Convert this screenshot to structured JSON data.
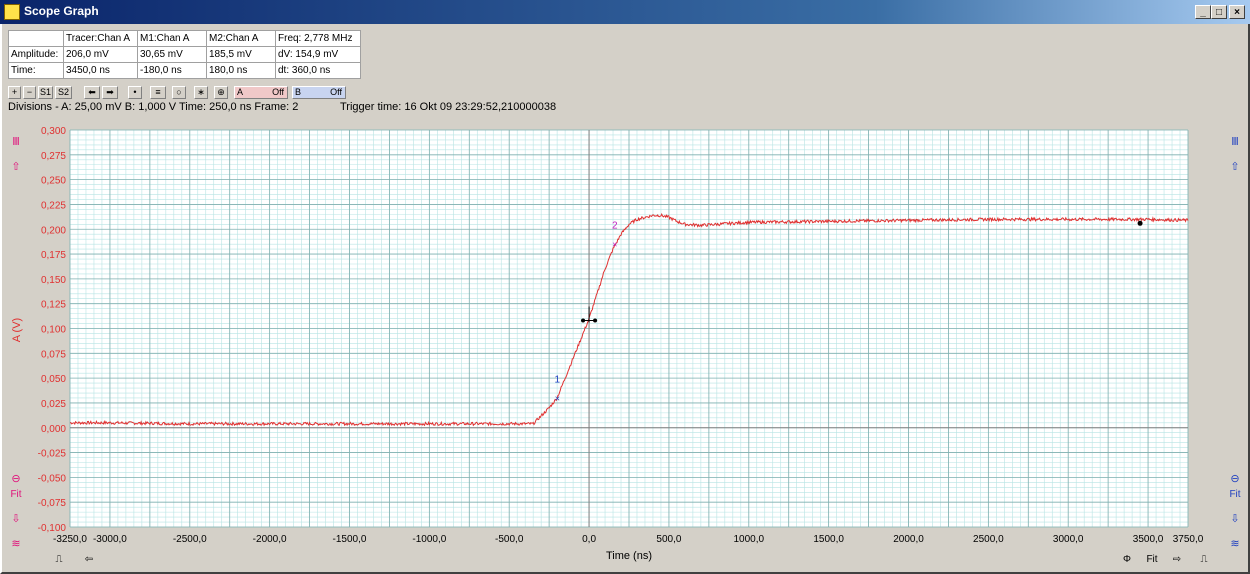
{
  "window": {
    "title": "Scope Graph"
  },
  "info_table": {
    "rows": [
      [
        "",
        "Tracer:Chan A",
        "M1:Chan A",
        "M2:Chan A",
        "Freq: 2,778 MHz"
      ],
      [
        "Amplitude:",
        "206,0 mV",
        "30,65 mV",
        "185,5 mV",
        "dV: 154,9 mV"
      ],
      [
        "Time:",
        "3450,0 ns",
        "-180,0 ns",
        "180,0 ns",
        "dt: 360,0 ns"
      ]
    ]
  },
  "toolbar": {
    "s1": "S1",
    "s2": "S2",
    "chan_a_label": "A",
    "chan_a_state": "Off",
    "chan_b_label": "B",
    "chan_b_state": "Off"
  },
  "status": {
    "divisions": "Divisions -  A: 25,00 mV    B: 1,000 V    Time: 250,0 ns   Frame: 2",
    "trigger": "Trigger time: 16 Okt 09 23:29:52,210000038"
  },
  "side_buttons": {
    "fit": "Fit"
  },
  "chart_data": {
    "type": "line",
    "xlabel": "Time (ns)",
    "ylabel": "A (V)",
    "xlim": [
      -3250,
      3750
    ],
    "ylim": [
      -0.1,
      0.3
    ],
    "x_ticks": [
      "-3250,0",
      "-3000,0",
      "-2500,0",
      "-2000,0",
      "-1500,0",
      "-1000,0",
      "-500,0",
      "0,0",
      "500,0",
      "1000,0",
      "1500,0",
      "2000,0",
      "2500,0",
      "3000,0",
      "3500,0",
      "3750,0"
    ],
    "x_tick_values": [
      -3250,
      -3000,
      -2500,
      -2000,
      -1500,
      -1000,
      -500,
      0,
      500,
      1000,
      1500,
      2000,
      2500,
      3000,
      3500,
      3750
    ],
    "y_ticks": [
      "0,300",
      "0,275",
      "0,250",
      "0,225",
      "0,200",
      "0,175",
      "0,150",
      "0,125",
      "0,100",
      "0,075",
      "0,050",
      "0,025",
      "0,000",
      "-0,025",
      "-0,050",
      "-0,075",
      "-0,100"
    ],
    "y_tick_values": [
      0.3,
      0.275,
      0.25,
      0.225,
      0.2,
      0.175,
      0.15,
      0.125,
      0.1,
      0.075,
      0.05,
      0.025,
      0,
      -0.025,
      -0.05,
      -0.075,
      -0.1
    ],
    "series": [
      {
        "color": "#e03030",
        "x": [
          -3250,
          -3000,
          -2500,
          -2000,
          -1500,
          -1000,
          -500,
          -350,
          -300,
          -250,
          -200,
          -150,
          -100,
          -50,
          0,
          50,
          100,
          150,
          200,
          250,
          300,
          350,
          400,
          450,
          500,
          550,
          600,
          700,
          800,
          1000,
          1500,
          2000,
          2500,
          3000,
          3500,
          3750
        ],
        "y": [
          0.005,
          0.005,
          0.004,
          0.004,
          0.004,
          0.004,
          0.004,
          0.004,
          0.012,
          0.02,
          0.03,
          0.05,
          0.07,
          0.09,
          0.11,
          0.135,
          0.16,
          0.18,
          0.195,
          0.205,
          0.21,
          0.212,
          0.214,
          0.214,
          0.212,
          0.208,
          0.205,
          0.204,
          0.205,
          0.207,
          0.208,
          0.209,
          0.21,
          0.21,
          0.21,
          0.209
        ]
      }
    ],
    "markers": [
      {
        "label": "1",
        "x": -180,
        "y": 0.03065,
        "color": "#2040c0"
      },
      {
        "label": "2",
        "x": 180,
        "y": 0.1855,
        "color": "#c020c0"
      }
    ],
    "tracer": {
      "x": 3450,
      "y": 0.206
    },
    "grid": true
  }
}
